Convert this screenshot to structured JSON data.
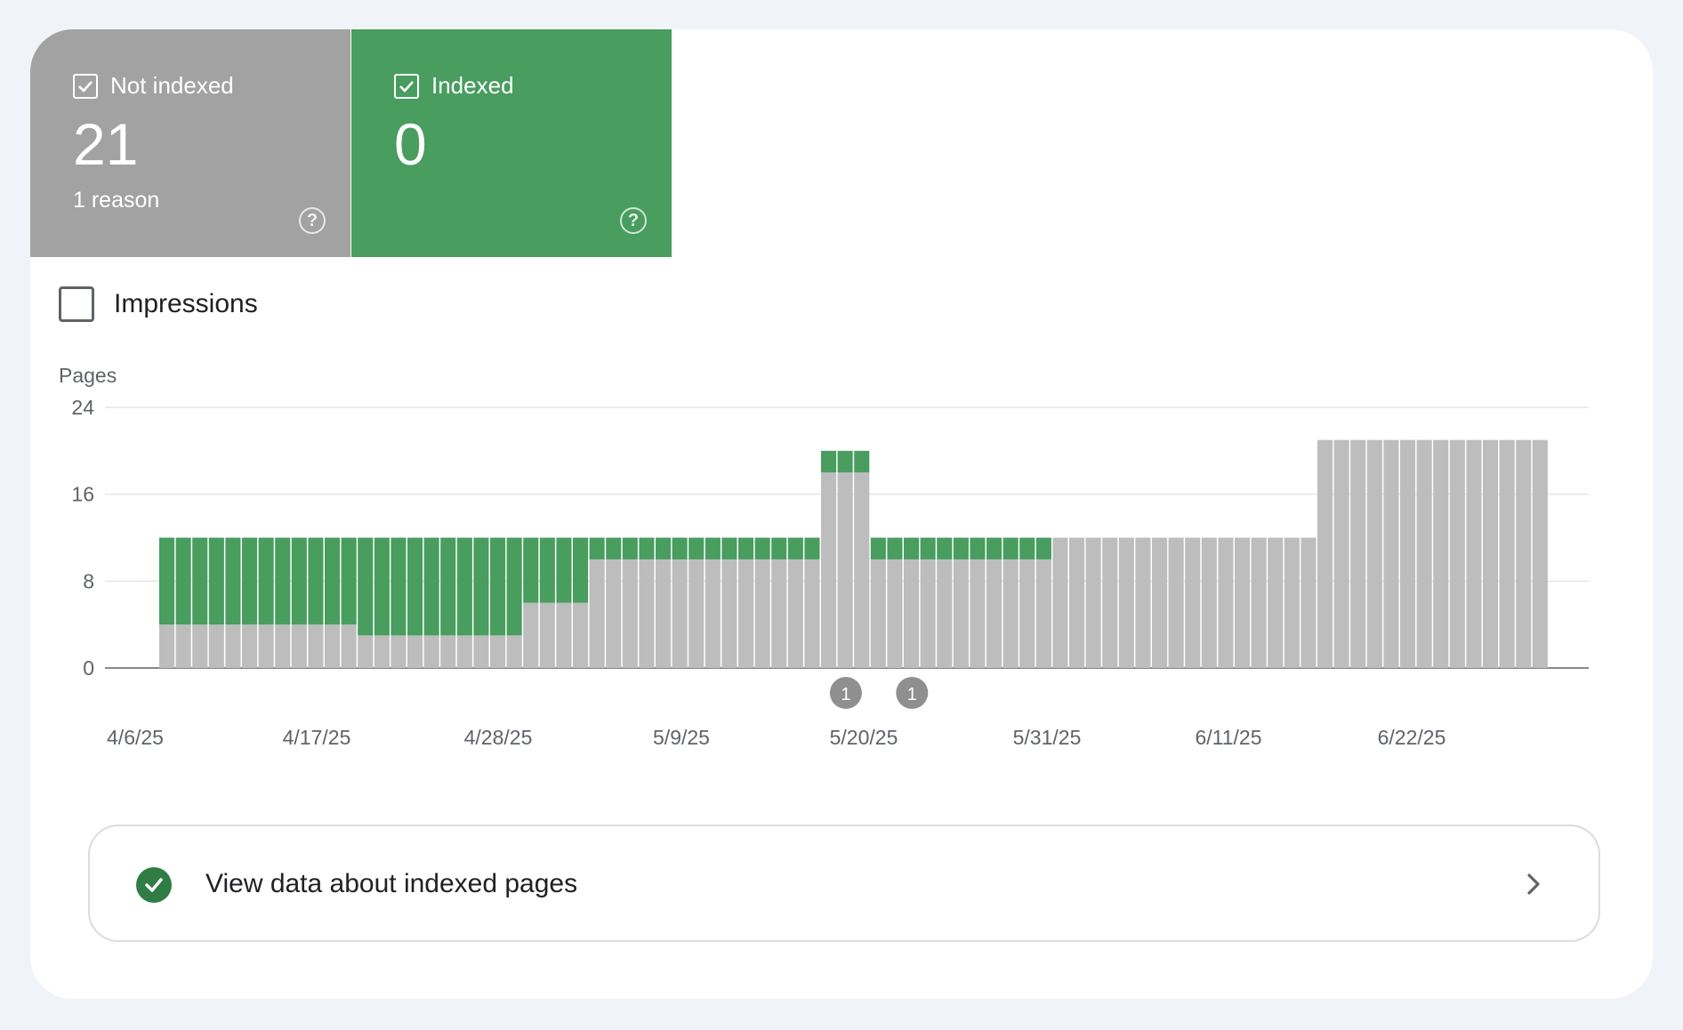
{
  "tiles": {
    "not_indexed": {
      "label": "Not indexed",
      "count": "21",
      "sub": "1 reason",
      "color": "#a2a2a2",
      "checked": true
    },
    "indexed": {
      "label": "Indexed",
      "count": "0",
      "sub": "",
      "color": "#489d5f",
      "checked": true
    }
  },
  "impressions": {
    "label": "Impressions",
    "checked": false
  },
  "chart_data": {
    "type": "bar",
    "stacked": true,
    "ylabel": "Pages",
    "ylim": [
      0,
      24
    ],
    "yticks": [
      "0",
      "8",
      "16",
      "24"
    ],
    "xtick_labels": [
      "4/6/25",
      "4/17/25",
      "4/28/25",
      "5/9/25",
      "5/20/25",
      "5/31/25",
      "6/11/25",
      "6/22/25"
    ],
    "x": [
      "4/9/25",
      "4/10/25",
      "4/11/25",
      "4/12/25",
      "4/13/25",
      "4/14/25",
      "4/15/25",
      "4/16/25",
      "4/17/25",
      "4/18/25",
      "4/19/25",
      "4/20/25",
      "4/21/25",
      "4/22/25",
      "4/23/25",
      "4/24/25",
      "4/25/25",
      "4/26/25",
      "4/27/25",
      "4/28/25",
      "4/29/25",
      "4/30/25",
      "5/1/25",
      "5/2/25",
      "5/3/25",
      "5/4/25",
      "5/5/25",
      "5/6/25",
      "5/7/25",
      "5/8/25",
      "5/9/25",
      "5/10/25",
      "5/11/25",
      "5/12/25",
      "5/13/25",
      "5/14/25",
      "5/15/25",
      "5/16/25",
      "5/17/25",
      "5/18/25",
      "5/19/25",
      "5/20/25",
      "5/21/25",
      "5/22/25",
      "5/23/25",
      "5/24/25",
      "5/25/25",
      "5/26/25",
      "5/27/25",
      "5/28/25",
      "5/29/25",
      "5/30/25",
      "5/31/25",
      "6/1/25",
      "6/2/25",
      "6/3/25",
      "6/4/25",
      "6/5/25",
      "6/6/25",
      "6/7/25",
      "6/8/25",
      "6/9/25",
      "6/10/25",
      "6/11/25",
      "6/12/25",
      "6/13/25",
      "6/14/25",
      "6/15/25",
      "6/16/25",
      "6/17/25",
      "6/18/25",
      "6/19/25",
      "6/20/25",
      "6/21/25",
      "6/22/25",
      "6/23/25",
      "6/24/25",
      "6/25/25",
      "6/26/25",
      "6/27/25",
      "6/28/25",
      "6/29/25",
      "6/30/25",
      "7/1/25"
    ],
    "series": [
      {
        "name": "Not indexed",
        "color": "#bdbdbd",
        "values": [
          4,
          4,
          4,
          4,
          4,
          4,
          4,
          4,
          4,
          4,
          4,
          4,
          3,
          3,
          3,
          3,
          3,
          3,
          3,
          3,
          3,
          3,
          6,
          6,
          6,
          6,
          10,
          10,
          10,
          10,
          10,
          10,
          10,
          10,
          10,
          10,
          10,
          10,
          10,
          10,
          18,
          18,
          18,
          10,
          10,
          10,
          10,
          10,
          10,
          10,
          10,
          10,
          10,
          10,
          12,
          12,
          12,
          12,
          12,
          12,
          12,
          12,
          12,
          12,
          12,
          12,
          12,
          12,
          12,
          12,
          21,
          21,
          21,
          21,
          21,
          21,
          21,
          21,
          21,
          21,
          21,
          21,
          21,
          21
        ]
      },
      {
        "name": "Indexed",
        "color": "#489d5f",
        "values": [
          8,
          8,
          8,
          8,
          8,
          8,
          8,
          8,
          8,
          8,
          8,
          8,
          9,
          9,
          9,
          9,
          9,
          9,
          9,
          9,
          9,
          9,
          6,
          6,
          6,
          6,
          2,
          2,
          2,
          2,
          2,
          2,
          2,
          2,
          2,
          2,
          2,
          2,
          2,
          2,
          2,
          2,
          2,
          2,
          2,
          2,
          2,
          2,
          2,
          2,
          2,
          2,
          2,
          2,
          0,
          0,
          0,
          0,
          0,
          0,
          0,
          0,
          0,
          0,
          0,
          0,
          0,
          0,
          0,
          0,
          0,
          0,
          0,
          0,
          0,
          0,
          0,
          0,
          0,
          0,
          0,
          0,
          0,
          0
        ]
      }
    ],
    "annotations": [
      {
        "x": "5/20/25",
        "label": "1"
      },
      {
        "x": "5/24/25",
        "label": "1"
      }
    ],
    "grid": true
  },
  "footer_link": {
    "label": "View data about indexed pages"
  }
}
